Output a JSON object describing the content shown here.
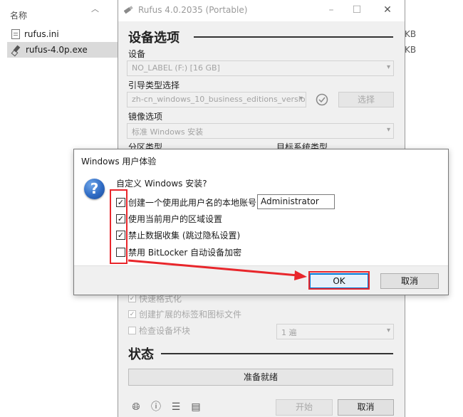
{
  "explorer": {
    "column_header": "名称",
    "files": [
      {
        "name": "rufus.ini",
        "size": "KB",
        "icon": "file-icon",
        "selected": false
      },
      {
        "name": "rufus-4.0p.exe",
        "size": "KB",
        "icon": "usb-drive-icon",
        "selected": true
      }
    ]
  },
  "rufus": {
    "title": "Rufus 4.0.2035 (Portable)",
    "window_controls": [
      "–",
      "☐",
      "✕"
    ],
    "device_options_heading": "设备选项",
    "device_label": "设备",
    "device_value": "NO_LABEL (F:) [16 GB]",
    "boot_selection_label": "引导类型选择",
    "boot_selection_value": "zh-cn_windows_10_business_editions_version",
    "select_button": "选择",
    "image_option_label": "镜像选项",
    "image_option_value": "标准 Windows 安装",
    "partition_label": "分区类型",
    "target_system_label": "目标系统类型",
    "quick_format_label": "快速格式化",
    "extended_label_label": "创建扩展的标签和图标文件",
    "bad_blocks_label": "检查设备坏块",
    "passes_value": "1 遍",
    "status_heading": "状态",
    "status_text": "准备就绪",
    "start_button": "开始",
    "cancel_button": "取消"
  },
  "dialog": {
    "title": "Windows 用户体验",
    "question": "自定义 Windows 安装?",
    "options": [
      {
        "label": "创建一个使用此用户名的本地账号:",
        "checked": true
      },
      {
        "label": "使用当前用户的区域设置",
        "checked": true
      },
      {
        "label": "禁止数据收集 (跳过隐私设置)",
        "checked": true
      },
      {
        "label": "禁用 BitLocker 自动设备加密",
        "checked": false
      }
    ],
    "account_value": "Administrator",
    "ok_button": "OK",
    "cancel_button": "取消"
  },
  "colors": {
    "annotation_red": "#e8262b",
    "ok_focus_blue": "#0078d7"
  }
}
